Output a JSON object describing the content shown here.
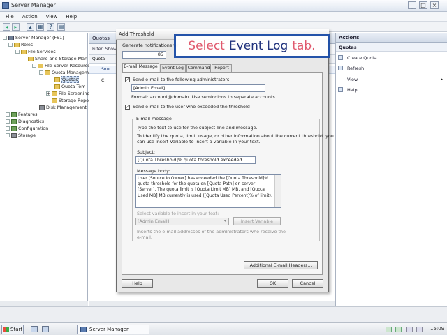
{
  "window": {
    "title": "Server Manager",
    "controls": [
      "_",
      "□",
      "×"
    ]
  },
  "menu": [
    "File",
    "Action",
    "View",
    "Help"
  ],
  "tree": {
    "items": [
      {
        "label": "Server Manager (FS1)",
        "icon": "server-icon",
        "exp": "−"
      },
      {
        "label": "Roles",
        "icon": "folder-icon",
        "exp": "−"
      },
      {
        "label": "File Services",
        "icon": "folder-icon",
        "exp": "−"
      },
      {
        "label": "Share and Storage Man",
        "icon": "folder-icon",
        "exp": ""
      },
      {
        "label": "File Server Resource",
        "icon": "folder-icon",
        "exp": "−"
      },
      {
        "label": "Quota Managem",
        "icon": "folder-icon",
        "exp": "−"
      },
      {
        "label": "Quotas",
        "icon": "folder-icon",
        "exp": "",
        "selected": true
      },
      {
        "label": "Quota Tem",
        "icon": "folder-icon",
        "exp": ""
      },
      {
        "label": "File Screening M",
        "icon": "folder-icon",
        "exp": "+"
      },
      {
        "label": "Storage Report",
        "icon": "folder-icon",
        "exp": ""
      },
      {
        "label": "Disk Management",
        "icon": "disk-icon",
        "exp": ""
      },
      {
        "label": "Features",
        "icon": "features-icon",
        "exp": "+"
      },
      {
        "label": "Diagnostics",
        "icon": "features-icon",
        "exp": "+"
      },
      {
        "label": "Configuration",
        "icon": "features-icon",
        "exp": "+"
      },
      {
        "label": "Storage",
        "icon": "disk-icon",
        "exp": "+"
      }
    ]
  },
  "middle": {
    "header": "Quotas",
    "filter": "Filter: Show",
    "column": "Quota",
    "group": "Sour",
    "row": "C:"
  },
  "actions": {
    "header": "Actions",
    "section": "Quotas",
    "items": [
      {
        "label": "Create Quota...",
        "arrow": ""
      },
      {
        "label": "Refresh",
        "arrow": ""
      },
      {
        "label": "View",
        "arrow": "▸"
      },
      {
        "label": "Help",
        "arrow": ""
      }
    ]
  },
  "taskbar": {
    "start": "Start",
    "task": "Server Manager",
    "clock": "15:09"
  },
  "dialog": {
    "title": "Add Threshold",
    "generate_label": "Generate notifications wh",
    "threshold_value": "85",
    "tabs": [
      "E-mail Message",
      "Event Log",
      "Command",
      "Report"
    ],
    "active_tab": "E-mail Message",
    "admin_check_label": "Send e-mail to the following administrators:",
    "admin_value": "[Admin Email]",
    "format_hint": "Format: account@domain. Use semicolons to separate accounts.",
    "user_check_label": "Send e-mail to the user who exceeded the threshold",
    "group_label": "E-mail message",
    "group_intro": "Type the text to use for the subject line and message.",
    "group_desc1": "To identify the quota, limit, usage, or other information about the current threshold, you",
    "group_desc2": "can use Insert Variable to insert a variable in your text.",
    "subject_label": "Subject:",
    "subject_value": "[Quota Threshold]% quota threshold exceeded",
    "body_label": "Message body:",
    "body_value": "User [Source Io Owner] has exceeded the [Quota Threshold]% quota threshold for the quota on [Quota Path] on server [Server]. The quota limit is [Quota Limit MB] MB, and [Quota Used MB] MB currently is used ([Quota Used Percent]% of limit).",
    "variable_label": "Select variable to insert in your text:",
    "variable_value": "[Admin Email]",
    "insert_button": "Insert Variable",
    "variable_desc1": "Inserts the e-mail addresses of the administrators who receive the",
    "variable_desc2": "e-mail.",
    "additional_button": "Additional E-mail Headers...",
    "help_button": "Help",
    "ok_button": "OK",
    "cancel_button": "Cancel"
  },
  "callout": {
    "part1": "Select",
    "part2": "Event Log",
    "part3": "tab."
  },
  "colors": {
    "callout_border": "#1e4fa7",
    "callout_red": "#e0556a",
    "callout_navy": "#1b2e7a"
  }
}
